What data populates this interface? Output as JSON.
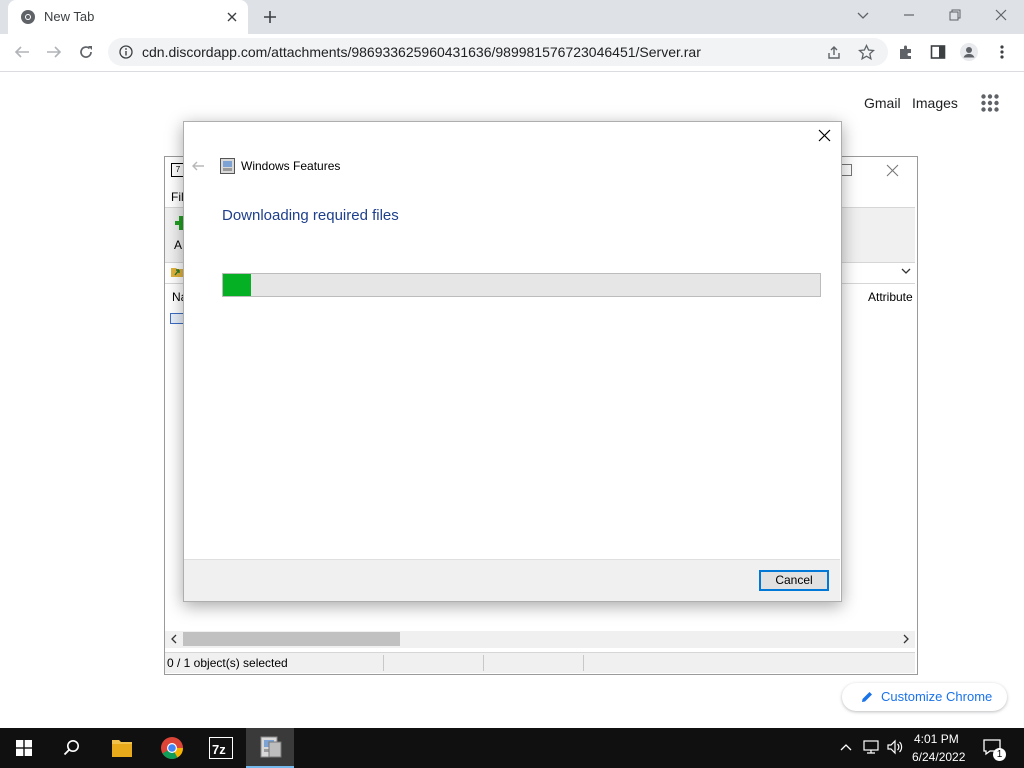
{
  "browser": {
    "tab_title": "New Tab",
    "url": "cdn.discordapp.com/attachments/986933625960431636/989981576723046451/Server.rar",
    "links": {
      "gmail": "Gmail",
      "images": "Images"
    },
    "customize_label": "Customize Chrome"
  },
  "zip_window": {
    "menu_partial": "Fil",
    "toolbar_partial": "A",
    "column_name_partial": "Na",
    "column_attributes": "Attribute",
    "status_selected": "0 / 1 object(s) selected"
  },
  "dialog": {
    "title": "Windows Features",
    "heading": "Downloading required files",
    "progress_fraction": 0.047,
    "cancel_label": "Cancel",
    "accent": "#06b025"
  },
  "taskbar": {
    "time": "4:01 PM",
    "date": "6/24/2022",
    "notification_count": "1",
    "apps": [
      "file-explorer-icon",
      "chrome-icon",
      "7zip-icon",
      "windows-features-icon"
    ]
  }
}
